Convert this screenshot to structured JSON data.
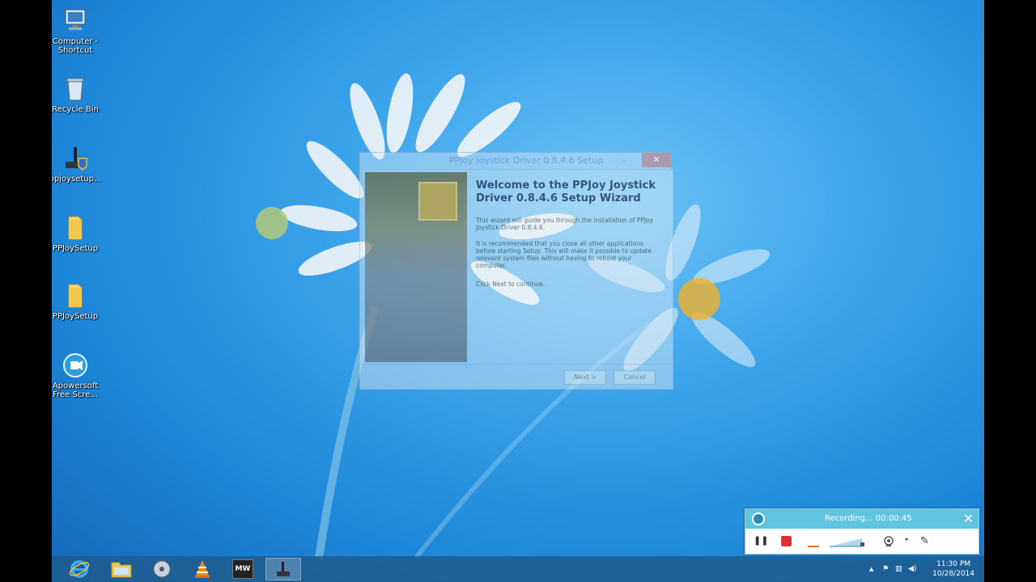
{
  "desktop": {
    "icons": [
      {
        "label": "Computer - Shortcut",
        "icon": "computer-icon"
      },
      {
        "label": "Recycle Bin",
        "icon": "recycle-bin-icon"
      },
      {
        "label": "ppjoysetup...",
        "icon": "installer-icon"
      },
      {
        "label": "PPJoySetup",
        "icon": "folder-icon"
      },
      {
        "label": "PPJoySetup",
        "icon": "folder-icon"
      },
      {
        "label": "Apowersoft Free Scre...",
        "icon": "apowersoft-icon"
      }
    ]
  },
  "wizard": {
    "title": "PPJoy Joystick Driver 0.8.4.6 Setup",
    "heading": "Welcome to the PPJoy Joystick Driver 0.8.4.6 Setup Wizard",
    "para1": "This wizard will guide you through the installation of PPJoy Joystick Driver 0.8.4.6.",
    "para2": "It is recommended that you close all other applications before starting Setup. This will make it possible to update relevant system files without having to reboot your computer.",
    "para3": "Click Next to continue.",
    "next_label": "Next >",
    "cancel_label": "Cancel",
    "minimize_label": "–",
    "close_label": "✕"
  },
  "recorder": {
    "status": "Recording... 00:00:45",
    "close_label": "✕",
    "pause_label": "❚❚",
    "pen_label": "✎"
  },
  "taskbar": {
    "apps": [
      {
        "name": "internet-explorer",
        "icon": "ie-icon"
      },
      {
        "name": "file-explorer",
        "icon": "folder-icon"
      },
      {
        "name": "media",
        "icon": "disc-icon"
      },
      {
        "name": "vlc",
        "icon": "vlc-icon"
      },
      {
        "name": "mw",
        "icon": "mw-icon",
        "text": "MW"
      },
      {
        "name": "ppjoy-setup",
        "icon": "installer-icon"
      }
    ],
    "clock_time": "11:30 PM",
    "clock_date": "10/28/2014",
    "tray_arrow": "▲"
  },
  "colors": {
    "accent": "#5ec4e0",
    "taskbar": "#1e5a8c",
    "record": "#e03030"
  }
}
